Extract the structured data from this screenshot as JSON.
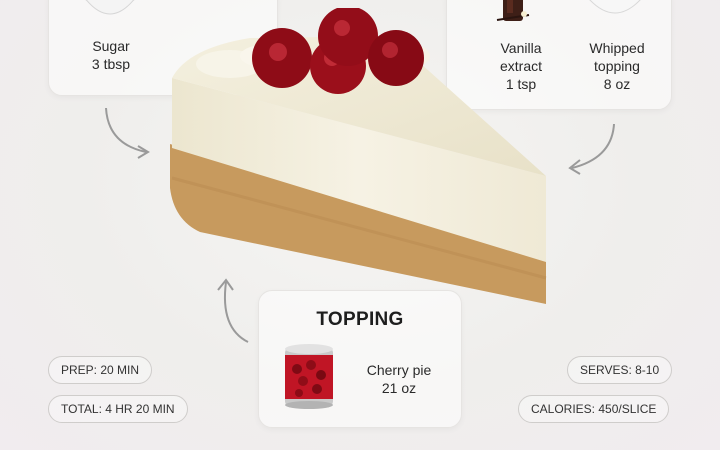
{
  "left_card": {
    "items": [
      {
        "name": "Sugar",
        "amount": "3 tbsp",
        "icon": "sugar-bowl-icon"
      }
    ]
  },
  "right_card": {
    "items": [
      {
        "name_line1": "Vanilla",
        "name_line2": "extract",
        "amount": "1 tsp",
        "icon": "vanilla-bottle-icon"
      },
      {
        "name_line1": "Whipped",
        "name_line2": "topping",
        "amount": "8 oz",
        "icon": "whipped-topping-bowl-icon"
      }
    ]
  },
  "topping": {
    "title": "TOPPING",
    "item_name": "Cherry pie",
    "item_amount": "21 oz",
    "icon": "cherry-can-icon"
  },
  "stats": {
    "prep": "PREP: 20 MIN",
    "total": "TOTAL: 4 HR 20 MIN",
    "serves": "SERVES: 8-10",
    "calories": "CALORIES: 450/SLICE"
  },
  "image": {
    "subject": "cheesecake-slice-with-cherries"
  },
  "colors": {
    "cherry": "#a3101c",
    "crust": "#c79a5e",
    "filling": "#f3efdf"
  }
}
